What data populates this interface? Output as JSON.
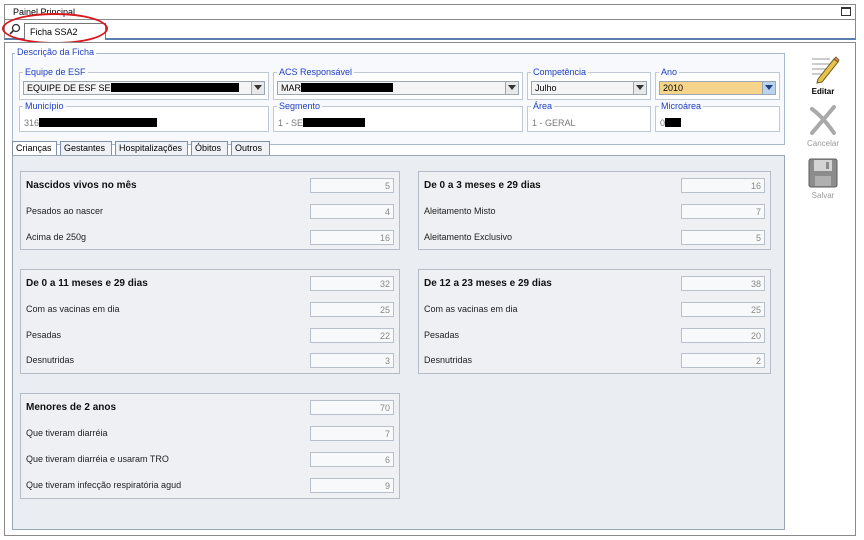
{
  "window": {
    "title": "Painel Principal"
  },
  "doc_tab": {
    "label": "Ficha SSA2"
  },
  "description": {
    "legend": "Descrição da Ficha",
    "equipe": {
      "label": "Equipe de ESF",
      "value": "EQUIPE DE ESF SE"
    },
    "acs": {
      "label": "ACS Responsável",
      "value": "MAR"
    },
    "competencia": {
      "label": "Competência",
      "value": "Julho"
    },
    "ano": {
      "label": "Ano",
      "value": "2010"
    },
    "municipio": {
      "label": "Município",
      "value": "316"
    },
    "segmento": {
      "label": "Segmento",
      "value": "1 - SE"
    },
    "area": {
      "label": "Área",
      "value": "1 - GERAL"
    },
    "microarea": {
      "label": "Microárea",
      "value": "0"
    }
  },
  "tabs": [
    {
      "label": "Crianças",
      "active": true
    },
    {
      "label": "Gestantes"
    },
    {
      "label": "Hospitalizações"
    },
    {
      "label": "Óbitos"
    },
    {
      "label": "Outros"
    }
  ],
  "groups": {
    "nascidos": {
      "rows": [
        {
          "label": "Nascidos vivos no mês",
          "value": "5"
        },
        {
          "label": "Pesados ao nascer",
          "value": "4"
        },
        {
          "label": "Acima de 250g",
          "value": "16"
        }
      ]
    },
    "zero_tres": {
      "rows": [
        {
          "label": "De 0 a 3 meses e 29 dias",
          "value": "16"
        },
        {
          "label": "Aleitamento Misto",
          "value": "7"
        },
        {
          "label": "Aleitamento Exclusivo",
          "value": "5"
        }
      ]
    },
    "zero_onze": {
      "rows": [
        {
          "label": "De 0 a 11 meses e 29 dias",
          "value": "32"
        },
        {
          "label": "Com as vacinas em dia",
          "value": "25"
        },
        {
          "label": "Pesadas",
          "value": "22"
        },
        {
          "label": "Desnutridas",
          "value": "3"
        }
      ]
    },
    "doze_vinte_tres": {
      "rows": [
        {
          "label": "De 12 a 23 meses e 29 dias",
          "value": "38"
        },
        {
          "label": "Com as vacinas em dia",
          "value": "25"
        },
        {
          "label": "Pesadas",
          "value": "20"
        },
        {
          "label": "Desnutridas",
          "value": "2"
        }
      ]
    },
    "menores_dois": {
      "rows": [
        {
          "label": "Menores de 2 anos",
          "value": "70"
        },
        {
          "label": "Que tiveram diarréia",
          "value": "7"
        },
        {
          "label": "Que tiveram diarréia e usaram TRO",
          "value": "6"
        },
        {
          "label": "Que tiveram infecção respiratória agud",
          "value": "9"
        }
      ]
    }
  },
  "toolbar": {
    "editar": "Editar",
    "cancelar": "Cancelar",
    "salvar": "Salvar"
  },
  "colors": {
    "accent_blue": "#1f3fc0",
    "highlight_ring": "#d8181e",
    "year_field": "#f6d58a",
    "panel_bg": "#eaedf2"
  }
}
